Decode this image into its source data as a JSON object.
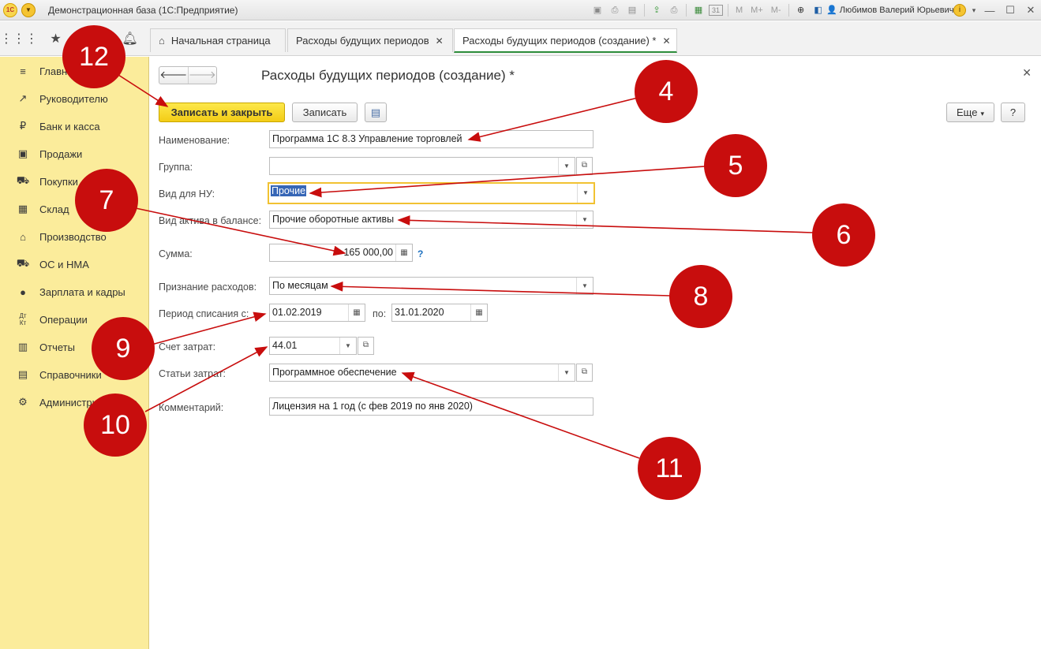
{
  "titlebar": {
    "logo_text": "1C",
    "title": "Демонстрационная база  (1С:Предприятие)",
    "m_label": "M",
    "mplus_label": "M+",
    "mminus_label": "M-",
    "calendar_label": "31",
    "user": "Любимов Валерий Юрьевич",
    "icons": [
      "save-icon",
      "print-icon",
      "preview-icon",
      "upload-icon",
      "print-icon",
      "calculator-icon",
      "calendar-icon",
      "zoom-icon",
      "panel-icon",
      "user-icon",
      "info-icon"
    ]
  },
  "tabs": [
    {
      "label": "Начальная страница",
      "closable": false
    },
    {
      "label": "Расходы будущих периодов",
      "closable": true
    },
    {
      "label": "Расходы будущих периодов (создание) *",
      "closable": true,
      "active": true
    }
  ],
  "sidebar": {
    "items": [
      {
        "label": "Главное",
        "icon": "menu-icon"
      },
      {
        "label": "Руководителю",
        "icon": "trend-icon"
      },
      {
        "label": "Банк и касса",
        "icon": "ruble-icon"
      },
      {
        "label": "Продажи",
        "icon": "bag-icon"
      },
      {
        "label": "Покупки",
        "icon": "cart-icon"
      },
      {
        "label": "Склад",
        "icon": "warehouse-icon"
      },
      {
        "label": "Производство",
        "icon": "factory-icon"
      },
      {
        "label": "ОС и НМА",
        "icon": "truck-icon"
      },
      {
        "label": "Зарплата и кадры",
        "icon": "person-icon"
      },
      {
        "label": "Операции",
        "icon": "debit-credit-icon"
      },
      {
        "label": "Отчеты",
        "icon": "bar-chart-icon"
      },
      {
        "label": "Справочники",
        "icon": "book-icon"
      },
      {
        "label": "Администрирование",
        "icon": "gear-icon"
      }
    ]
  },
  "form": {
    "title": "Расходы будущих периодов (создание) *",
    "toolbar": {
      "save_close": "Записать и закрыть",
      "save": "Записать",
      "more": "Еще",
      "help": "?"
    },
    "fields": {
      "name": {
        "label": "Наименование:",
        "value": "Программа 1С 8.3 Управление торговлей"
      },
      "group": {
        "label": "Группа:",
        "value": ""
      },
      "nu_type": {
        "label": "Вид для НУ:",
        "value": "Прочие"
      },
      "asset_type": {
        "label": "Вид актива в балансе:",
        "value": "Прочие оборотные активы"
      },
      "amount": {
        "label": "Сумма:",
        "value": "165 000,00",
        "help": "?"
      },
      "recognition": {
        "label": "Признание расходов:",
        "value": "По месяцам"
      },
      "period": {
        "label": "Период списания с:",
        "from": "01.02.2019",
        "to_label": "по:",
        "to": "31.01.2020"
      },
      "account": {
        "label": "Счет затрат:",
        "value": "44.01"
      },
      "cost_item": {
        "label": "Статьи затрат:",
        "value": "Программное обеспечение"
      },
      "comment": {
        "label": "Комментарий:",
        "value": "Лицензия на 1 год (с фев 2019 по янв 2020)"
      }
    }
  },
  "annotations": {
    "badges": [
      "12",
      "4",
      "5",
      "7",
      "6",
      "8",
      "9",
      "10",
      "11"
    ],
    "color": "#c80d0d"
  }
}
